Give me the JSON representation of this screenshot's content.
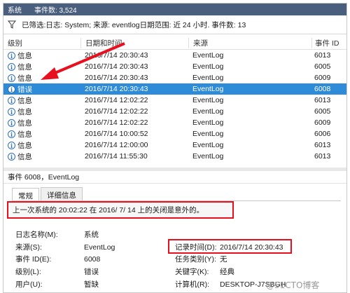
{
  "titlebar": {
    "name": "系统",
    "event_count": "事件数: 3,524"
  },
  "filter": {
    "text": "已筛选:日志: System; 来源: eventlog日期范围: 近 24 小时. 事件数: 13"
  },
  "grid": {
    "headers": [
      "级别",
      "日期和时间",
      "来源",
      "事件 ID"
    ],
    "rows": [
      {
        "level": "信息",
        "datetime": "2016/7/14 20:30:43",
        "source": "EventLog",
        "id": "6013"
      },
      {
        "level": "信息",
        "datetime": "2016/7/14 20:30:43",
        "source": "EventLog",
        "id": "6005"
      },
      {
        "level": "信息",
        "datetime": "2016/7/14 20:30:43",
        "source": "EventLog",
        "id": "6009"
      },
      {
        "level": "错误",
        "datetime": "2016/7/14 20:30:43",
        "source": "EventLog",
        "id": "6008"
      },
      {
        "level": "信息",
        "datetime": "2016/7/14 12:02:22",
        "source": "EventLog",
        "id": "6013"
      },
      {
        "level": "信息",
        "datetime": "2016/7/14 12:02:22",
        "source": "EventLog",
        "id": "6005"
      },
      {
        "level": "信息",
        "datetime": "2016/7/14 12:02:22",
        "source": "EventLog",
        "id": "6009"
      },
      {
        "level": "信息",
        "datetime": "2016/7/14 10:00:52",
        "source": "EventLog",
        "id": "6006"
      },
      {
        "level": "信息",
        "datetime": "2016/7/14 12:00:00",
        "source": "EventLog",
        "id": "6013"
      },
      {
        "level": "信息",
        "datetime": "2016/7/14 11:55:30",
        "source": "EventLog",
        "id": "6013"
      }
    ]
  },
  "detail": {
    "title": "事件 6008，EventLog",
    "tabs": [
      "常规",
      "详细信息"
    ],
    "message": "上一次系统的 20:02:22 在    2016/   7/   14 上的关闭是意外的。",
    "props": {
      "log_name_label": "日志名称(M):",
      "log_name_value": "系统",
      "source_label": "来源(S):",
      "source_value": "EventLog",
      "logged_label": "记录时间(D):",
      "logged_value": "2016/7/14 20:30:43",
      "event_id_label": "事件 ID(E):",
      "event_id_value": "6008",
      "task_label": "任务类别(Y):",
      "task_value": "无",
      "level_label": "级别(L):",
      "level_value": "错误",
      "keywords_label": "关键字(K):",
      "keywords_value": "经典",
      "user_label": "用户(U):",
      "user_value": "暂缺",
      "computer_label": "计算机(R):",
      "computer_value": "DESKTOP-J7SBGH"
    }
  },
  "watermarks": {
    "blog": "@51CTO博客"
  },
  "colors": {
    "titlebar": "#4a5e7d",
    "selected": "#2e8bd8",
    "highlight": "#e8101e"
  }
}
